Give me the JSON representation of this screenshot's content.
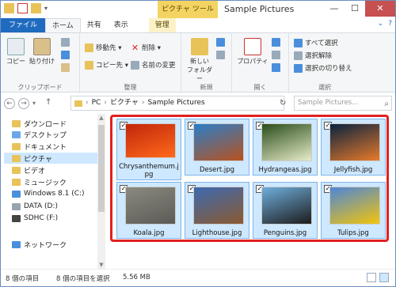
{
  "window": {
    "title": "Sample Pictures",
    "context_tab": "ピクチャ ツール"
  },
  "ribbon_tabs": [
    "ファイル",
    "ホーム",
    "共有",
    "表示",
    "管理"
  ],
  "ribbon": {
    "clipboard": {
      "label": "クリップボード",
      "copy": "コピー",
      "paste": "貼り付け"
    },
    "organize": {
      "label": "整理",
      "move_to": "移動先 ▾",
      "copy_to": "コピー先 ▾",
      "delete": "削除 ▾",
      "rename": "名前の変更"
    },
    "new": {
      "label": "新規",
      "new_folder_line1": "新しい",
      "new_folder_line2": "フォルダー"
    },
    "open": {
      "label": "開く",
      "properties": "プロパティ"
    },
    "select": {
      "label": "選択",
      "select_all": "すべて選択",
      "select_none": "選択解除",
      "invert": "選択の切り替え"
    }
  },
  "address": {
    "path": [
      "PC",
      "ピクチャ",
      "Sample Pictures"
    ],
    "search_placeholder": "Sample Pictures..."
  },
  "nav": {
    "items": [
      {
        "label": "ダウンロード",
        "icon": "folder-icon",
        "color": "#e8c35a",
        "selected": false
      },
      {
        "label": "デスクトップ",
        "icon": "folder-icon",
        "color": "#6ba7e8",
        "selected": false
      },
      {
        "label": "ドキュメント",
        "icon": "folder-icon",
        "color": "#e8c35a",
        "selected": false
      },
      {
        "label": "ピクチャ",
        "icon": "folder-icon",
        "color": "#e8c35a",
        "selected": true
      },
      {
        "label": "ビデオ",
        "icon": "folder-icon",
        "color": "#e8c35a",
        "selected": false
      },
      {
        "label": "ミュージック",
        "icon": "folder-icon",
        "color": "#e8c35a",
        "selected": false
      },
      {
        "label": "Windows 8.1 (C:)",
        "icon": "drive-icon",
        "color": "#4a8fdc",
        "selected": false
      },
      {
        "label": "DATA (D:)",
        "icon": "drive-icon",
        "color": "#9aa4ae",
        "selected": false
      },
      {
        "label": "SDHC (F:)",
        "icon": "sd-card-icon",
        "color": "#444444",
        "selected": false
      },
      {
        "label": "ネットワーク",
        "icon": "network-icon",
        "color": "#4a8fdc",
        "selected": false
      }
    ]
  },
  "files": [
    {
      "name": "Chrysanthemum.jpg",
      "colors": [
        "#c1260c",
        "#ff6a1a"
      ]
    },
    {
      "name": "Desert.jpg",
      "colors": [
        "#2a7ec9",
        "#b8521e"
      ]
    },
    {
      "name": "Hydrangeas.jpg",
      "colors": [
        "#2b4d1c",
        "#e6ecc8"
      ]
    },
    {
      "name": "Jellyfish.jpg",
      "colors": [
        "#08223f",
        "#e87a2a"
      ]
    },
    {
      "name": "Koala.jpg",
      "colors": [
        "#8a8a80",
        "#5c5a55"
      ]
    },
    {
      "name": "Lighthouse.jpg",
      "colors": [
        "#3d6ab0",
        "#8a5a30"
      ]
    },
    {
      "name": "Penguins.jpg",
      "colors": [
        "#6faedc",
        "#1c1c1c"
      ]
    },
    {
      "name": "Tulips.jpg",
      "colors": [
        "#4d86d8",
        "#f2c40c"
      ]
    }
  ],
  "status": {
    "item_count": "8 個の項目",
    "selected": "8 個の項目を選択",
    "size": "5.56 MB"
  },
  "colors": {
    "accent": "#1f6bc0",
    "selection_frame": "#e22020",
    "selection_fill": "#cde8ff"
  }
}
